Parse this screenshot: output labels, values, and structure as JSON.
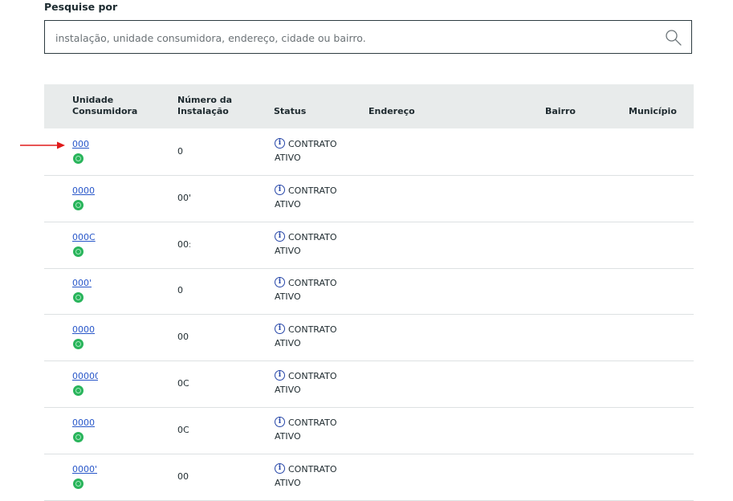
{
  "search": {
    "label": "Pesquise por",
    "placeholder": "instalação, unidade consumidora, endereço, cidade ou bairro."
  },
  "table": {
    "headers": {
      "uc": "Unidade Consumidora",
      "installation": "Número da Instalação",
      "status": "Status",
      "address": "Endereço",
      "neighborhood": "Bairro",
      "city": "Município"
    },
    "rows": [
      {
        "uc": "000",
        "installation": "0",
        "status_line1": "CONTRATO",
        "status_line2": "ATIVO"
      },
      {
        "uc": "0000",
        "installation": "00'",
        "status_line1": "CONTRATO",
        "status_line2": "ATIVO"
      },
      {
        "uc": "000C",
        "installation": "00:",
        "status_line1": "CONTRATO",
        "status_line2": "ATIVO"
      },
      {
        "uc": "000'",
        "installation": "0",
        "status_line1": "CONTRATO",
        "status_line2": "ATIVO"
      },
      {
        "uc": "0000",
        "installation": "00",
        "status_line1": "CONTRATO",
        "status_line2": "ATIVO"
      },
      {
        "uc": "00000",
        "installation": "0C",
        "status_line1": "CONTRATO",
        "status_line2": "ATIVO"
      },
      {
        "uc": "0000",
        "installation": "0C",
        "status_line1": "CONTRATO",
        "status_line2": "ATIVO"
      },
      {
        "uc": "0000'",
        "installation": "00",
        "status_line1": "CONTRATO",
        "status_line2": "ATIVO"
      }
    ]
  },
  "colors": {
    "link": "#2857c9",
    "active_status": "#29b45b",
    "info_icon": "#2646a8",
    "header_bg": "#e8ebeb",
    "annotation_arrow": "#e01b1b"
  },
  "icons": {
    "search": "search-icon",
    "info": "info-icon",
    "status": "status-ok-icon"
  }
}
